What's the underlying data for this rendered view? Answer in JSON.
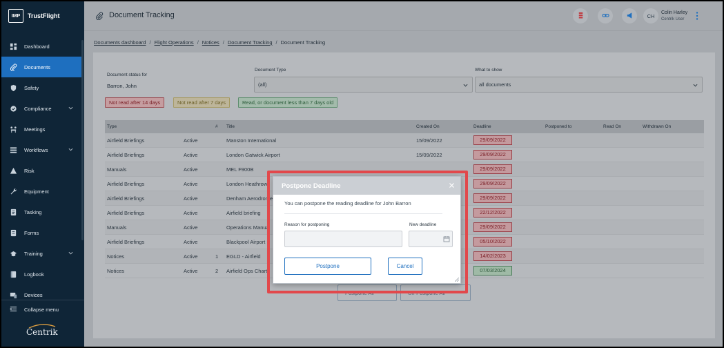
{
  "brand": {
    "logo": "IMP",
    "name": "TrustFlight"
  },
  "sidebar": {
    "items": [
      {
        "label": "Dashboard",
        "icon": "dashboard-icon",
        "chevron": false,
        "active": false
      },
      {
        "label": "Documents",
        "icon": "paperclip-icon",
        "chevron": false,
        "active": true
      },
      {
        "label": "Safety",
        "icon": "shield-icon",
        "chevron": false,
        "active": false
      },
      {
        "label": "Compliance",
        "icon": "compliance-icon",
        "chevron": true,
        "active": false
      },
      {
        "label": "Meetings",
        "icon": "meetings-icon",
        "chevron": false,
        "active": false
      },
      {
        "label": "Workflows",
        "icon": "workflows-icon",
        "chevron": true,
        "active": false
      },
      {
        "label": "Risk",
        "icon": "warning-icon",
        "chevron": false,
        "active": false
      },
      {
        "label": "Equipment",
        "icon": "wrench-icon",
        "chevron": false,
        "active": false
      },
      {
        "label": "Tasking",
        "icon": "tasking-icon",
        "chevron": false,
        "active": false
      },
      {
        "label": "Forms",
        "icon": "forms-icon",
        "chevron": false,
        "active": false
      },
      {
        "label": "Training",
        "icon": "graduation-cap-icon",
        "chevron": true,
        "active": false
      },
      {
        "label": "Logbook",
        "icon": "book-icon",
        "chevron": false,
        "active": false
      },
      {
        "label": "Devices",
        "icon": "devices-icon",
        "chevron": false,
        "active": false
      }
    ],
    "collapse_label": "Collapse menu",
    "footer_logo": "Centrik"
  },
  "topbar": {
    "title": "Document Tracking",
    "user_initials": "CH",
    "user_name": "Colin Harley",
    "user_role": "Centrik User"
  },
  "breadcrumb": [
    "Documents dashboard",
    "Flight Operations",
    "Notices",
    "Document Tracking",
    "Document Tracking"
  ],
  "filters": {
    "status_label": "Document status for",
    "status_value": "Barron, John",
    "type_label": "Document Type",
    "type_value": "(all)",
    "show_label": "What to show",
    "show_value": "all documents"
  },
  "legend": {
    "red": "Not read after 14 days",
    "yellow": "Not read after 7 days",
    "green": "Read, or document less than 7 days old"
  },
  "table": {
    "headers": [
      "Type",
      "",
      "#",
      "Title",
      "Created On",
      "Deadline",
      "Postponed to",
      "Read On",
      "Withdrawn On"
    ],
    "rows": [
      {
        "type": "Airfield Briefings",
        "status": "Active",
        "num": "",
        "title": "Manston International",
        "created": "15/09/2022",
        "deadline": "29/09/2022",
        "color": "red"
      },
      {
        "type": "Airfield Briefings",
        "status": "Active",
        "num": "",
        "title": "London Gatwick Airport",
        "created": "15/09/2022",
        "deadline": "29/09/2022",
        "color": "red"
      },
      {
        "type": "Manuals",
        "status": "Active",
        "num": "",
        "title": "MEL F900B",
        "created": "",
        "deadline": "29/09/2022",
        "color": "red"
      },
      {
        "type": "Airfield Briefings",
        "status": "Active",
        "num": "",
        "title": "London Heathrow",
        "created": "",
        "deadline": "29/09/2022",
        "color": "red"
      },
      {
        "type": "Airfield Briefings",
        "status": "Active",
        "num": "",
        "title": "Denham Aerodrome",
        "created": "",
        "deadline": "29/09/2022",
        "color": "red"
      },
      {
        "type": "Airfield Briefings",
        "status": "Active",
        "num": "",
        "title": "Airfield briefing",
        "created": "",
        "deadline": "22/12/2022",
        "color": "red"
      },
      {
        "type": "Manuals",
        "status": "Active",
        "num": "",
        "title": "Operations Manual",
        "created": "",
        "deadline": "29/09/2022",
        "color": "red"
      },
      {
        "type": "Airfield Briefings",
        "status": "Active",
        "num": "",
        "title": "Blackpool Airport",
        "created": "",
        "deadline": "05/10/2022",
        "color": "red"
      },
      {
        "type": "Notices",
        "status": "Active",
        "num": "1",
        "title": "EGLD - Airfield",
        "created": "",
        "deadline": "14/02/2023",
        "color": "red"
      },
      {
        "type": "Notices",
        "status": "Active",
        "num": "2",
        "title": "Airfield Ops Chart",
        "created": "",
        "deadline": "07/03/2024",
        "color": "green"
      }
    ]
  },
  "bottom_buttons": {
    "postpone_all": "Postpone All",
    "unpostpone_all": "Un-Postpone All"
  },
  "modal": {
    "title": "Postpone Deadline",
    "message": "You can postpone the reading deadline for John Barron",
    "reason_label": "Reason for postponing",
    "reason_value": "",
    "deadline_label": "New deadline",
    "deadline_value": "",
    "postpone_label": "Postpone",
    "cancel_label": "Cancel"
  },
  "colors": {
    "sidebar": "#0f2537",
    "accent": "#1e6fbf",
    "highlight": "#e2484b"
  }
}
